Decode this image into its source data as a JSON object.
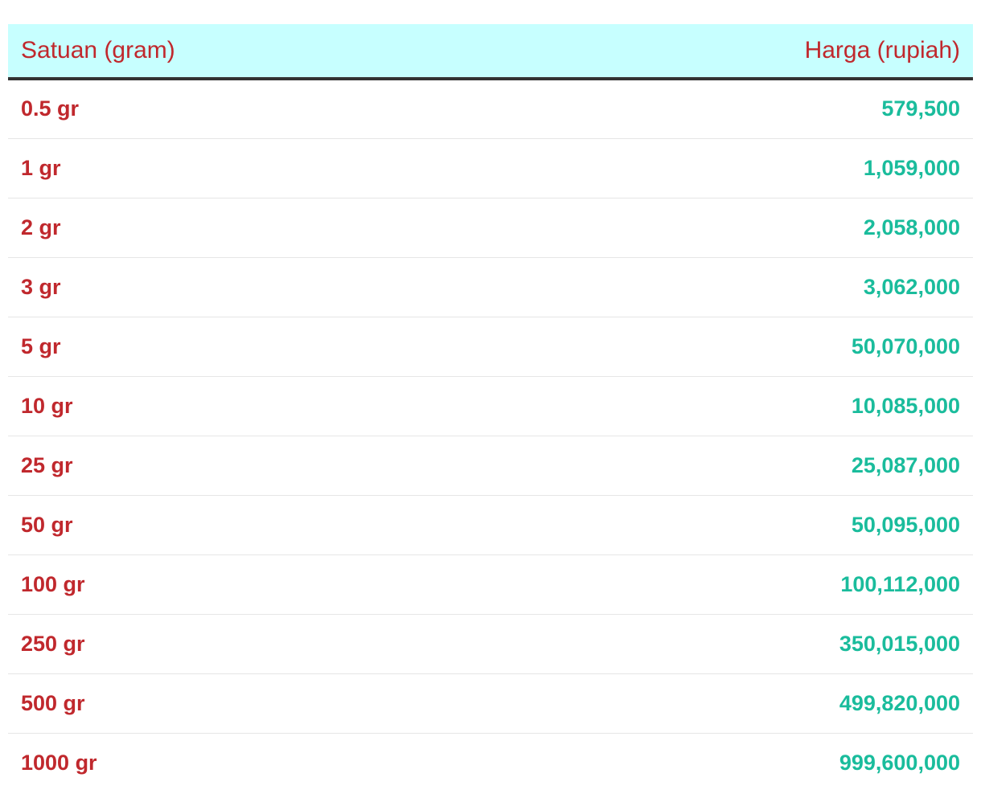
{
  "table": {
    "headers": {
      "unit": "Satuan (gram)",
      "price": "Harga (rupiah)"
    },
    "rows": [
      {
        "unit": "0.5 gr",
        "price": "579,500"
      },
      {
        "unit": "1 gr",
        "price": "1,059,000"
      },
      {
        "unit": "2 gr",
        "price": "2,058,000"
      },
      {
        "unit": "3 gr",
        "price": "3,062,000"
      },
      {
        "unit": "5 gr",
        "price": "50,070,000"
      },
      {
        "unit": "10 gr",
        "price": "10,085,000"
      },
      {
        "unit": "25 gr",
        "price": "25,087,000"
      },
      {
        "unit": "50 gr",
        "price": "50,095,000"
      },
      {
        "unit": "100 gr",
        "price": "100,112,000"
      },
      {
        "unit": "250 gr",
        "price": "350,015,000"
      },
      {
        "unit": "500 gr",
        "price": "499,820,000"
      },
      {
        "unit": "1000 gr",
        "price": "999,600,000"
      }
    ]
  },
  "colors": {
    "header_background": "#c7ffff",
    "header_text": "#c0282d",
    "unit_text": "#c0282d",
    "price_text": "#1abc9c",
    "header_rule": "#333333",
    "row_divider": "#e6e6e6"
  }
}
